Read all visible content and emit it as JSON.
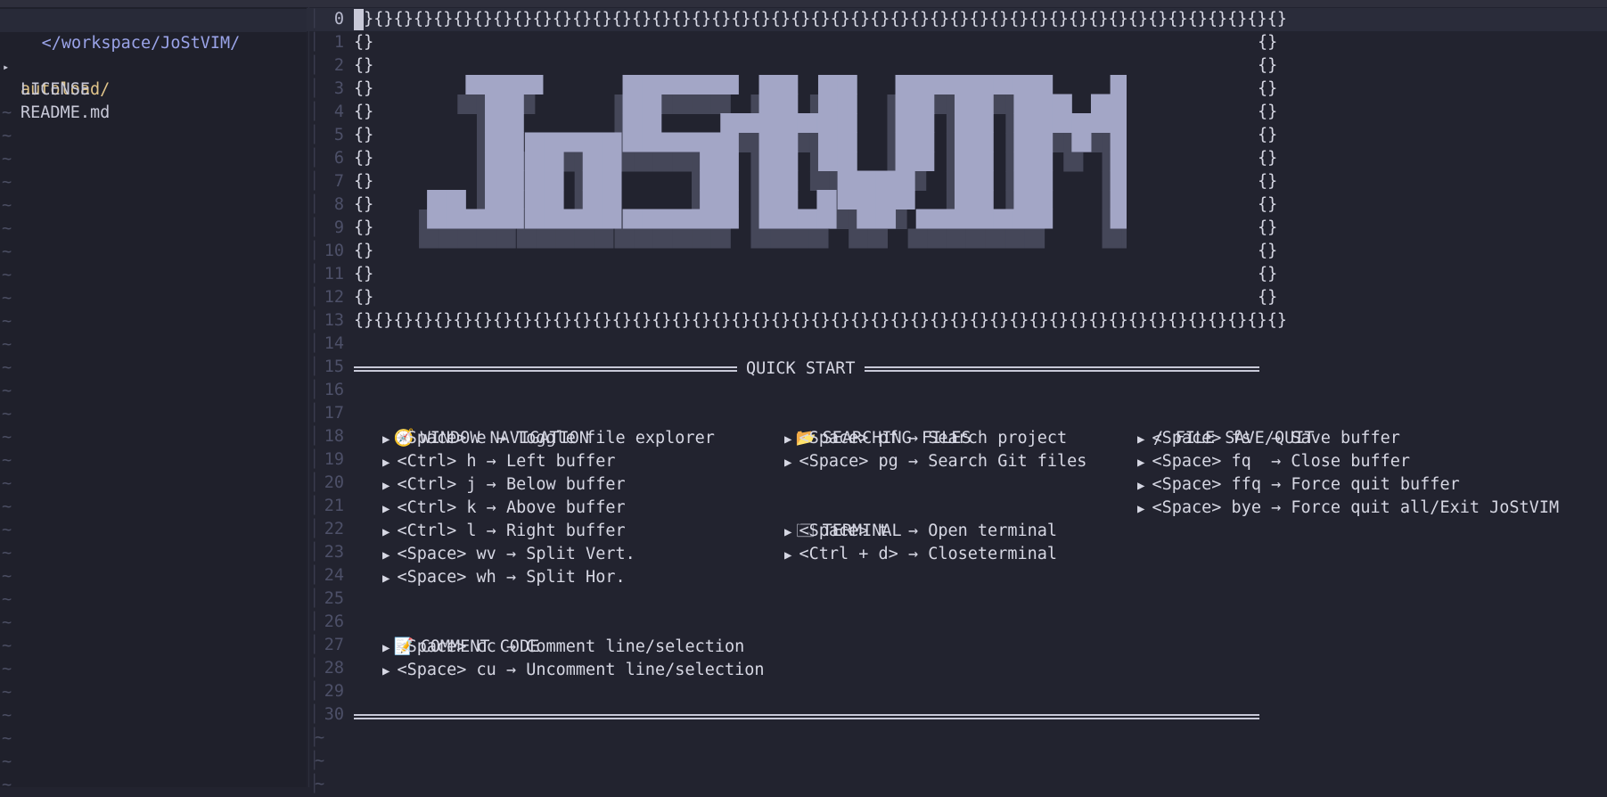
{
  "explorer": {
    "path": "</workspace/JoStVIM/",
    "items": [
      {
        "arrow": "▸",
        "name": "autoload/",
        "type": "dir"
      },
      {
        "arrow": "",
        "name": "LICENSE",
        "type": "file"
      },
      {
        "arrow": "",
        "name": "README.md",
        "type": "file"
      }
    ],
    "tilde": "~"
  },
  "editor": {
    "line_numbers": [
      "0",
      "1",
      "2",
      "3",
      "4",
      "5",
      "6",
      "7",
      "8",
      "9",
      "10",
      "11",
      "12",
      "13",
      "14",
      "15",
      "16",
      "17",
      "18",
      "19",
      "20",
      "21",
      "22",
      "23",
      "24",
      "25",
      "26",
      "27",
      "28",
      "29",
      "30"
    ],
    "brace_row": "{}{}{}{}{}{}{}{}{}{}{}{}{}{}{}{}{}{}{}{}{}{}{}{}{}{}{}{}{}{}{}{}{}{}{}{}{}{}{}{}{}{}{}{}{}{}{}",
    "brace": "{}",
    "logo_text": "JoStVIM",
    "quick_start": "QUICK START",
    "sections": {
      "window_nav": {
        "icon": "🧭",
        "title": "WINDOW NAVIGATION",
        "items": [
          "<Space> e → Toggle file explorer",
          "<Ctrl> h → Left buffer",
          "<Ctrl> j → Below buffer",
          "<Ctrl> k → Above buffer",
          "<Ctrl> l → Right buffer",
          "<Space> wv → Split Vert.",
          "<Space> wh → Split Hor."
        ]
      },
      "searching": {
        "icon": "📂",
        "title": "SEARCHING FILES",
        "items": [
          "<Space> pf → Search project",
          "<Space> pg → Search Git files"
        ]
      },
      "terminal": {
        "icon": "🗔",
        "title": "TERMINAL",
        "items": [
          "<Space> t  → Open terminal",
          "<Ctrl + d> → Closeterminal"
        ]
      },
      "file_save": {
        "icon": "/",
        "title": "FILE SAVE/QUIT",
        "items": [
          "<Space> fs  → Save buffer",
          "<Space> fq  → Close buffer",
          "<Space> ffq → Force quit buffer",
          "<Space> bye → Force quit all/Exit JoStVIM"
        ]
      },
      "comment": {
        "icon": "📝",
        "title": "COMMENT CODE",
        "items": [
          "<Space> cc → Comment line/selection",
          "<Space> cu → Uncomment line/selection"
        ]
      }
    },
    "bullet": "▶",
    "tilde": "~"
  },
  "colors": {
    "background": "#22232f",
    "explorer_bg": "#1f202b",
    "logo_front": "#a3a6c6",
    "logo_shadow": "#454759"
  }
}
